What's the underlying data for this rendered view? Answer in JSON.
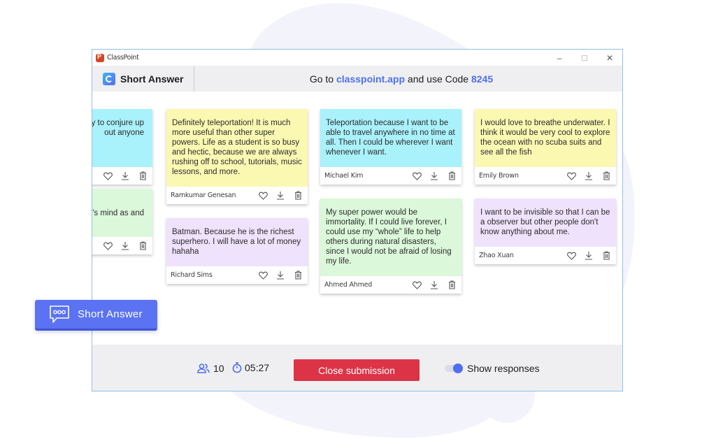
{
  "window": {
    "app_title": "ClassPoint",
    "controls": {
      "minimize": "–",
      "maximize": "",
      "close": "✕"
    }
  },
  "header": {
    "title": "Short Answer",
    "instruction_prefix": "Go to ",
    "link": "classpoint.app",
    "instruction_middle": " and use Code ",
    "code": "8245"
  },
  "colors": {
    "accent": "#4f6ff0",
    "close_button": "#dc3446",
    "card_yellow": "#fbf8b2",
    "card_cyan": "#a9f1fb",
    "card_green": "#dbf8da",
    "card_purple": "#efe2fc"
  },
  "cards": [
    {
      "text": "y to conjure up\nout anyone",
      "name": "",
      "color": "cyan"
    },
    {
      "text": "'s mind as and",
      "name": "",
      "color": "green"
    },
    {
      "text": "Definitely teleportation! It is much more useful than other super powers. Life as a student is so busy and hectic, because we are always rushing off to school, tutorials, music lessons, and more.",
      "name": "Ramkumar Genesan",
      "color": "yellow"
    },
    {
      "text": "Batman. Because he is the richest superhero. I will have a lot of money hahaha",
      "name": "Richard Sims",
      "color": "purple"
    },
    {
      "text": "Teleportation because I want to be able to travel anywhere in no time at all. Then I could be wherever I want whenever I want.",
      "name": "Michael Kim",
      "color": "cyan"
    },
    {
      "text": "My super power would be immortality. If I could live forever, I could use my “whole” life to help others during natural disasters, since I would not be afraid of losing my life.",
      "name": "Ahmed Ahmed",
      "color": "green"
    },
    {
      "text": "I would love to breathe underwater. I think it would be very cool to explore the ocean with no scuba suits and see all the fish",
      "name": "Emily Brown",
      "color": "yellow"
    },
    {
      "text": "I want to be invisible so that I can be a observer but other people don't know anything about me.",
      "name": "Zhao Xuan",
      "color": "purple"
    }
  ],
  "card_actions": {
    "like": "heart-icon",
    "download": "download-icon",
    "delete": "trash-icon"
  },
  "footer": {
    "participants": "10",
    "timer": "05:27",
    "close_label": "Close submission",
    "toggle_label": "Show responses",
    "toggle_on": true
  },
  "floating_button": {
    "label": "Short Answer"
  }
}
